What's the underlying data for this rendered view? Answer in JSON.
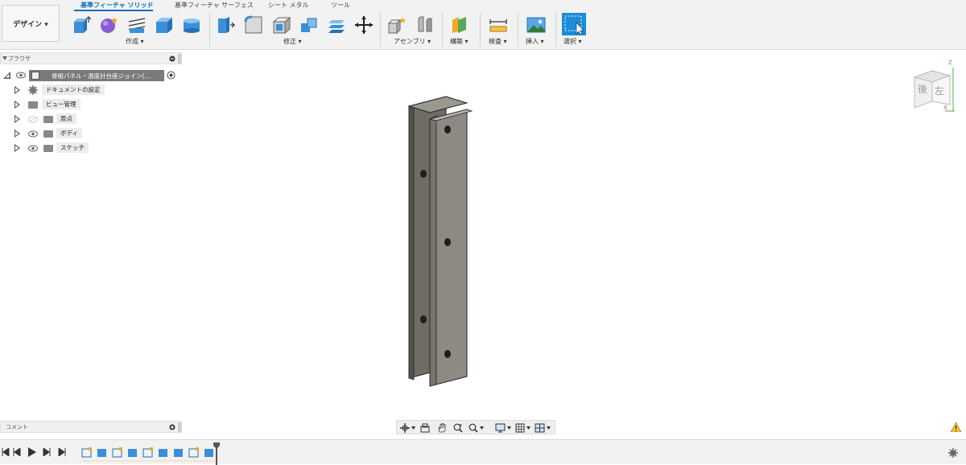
{
  "workspace": {
    "label": "デザイン ▾"
  },
  "tabs": [
    {
      "label": "基準フィーチャ ソリッド",
      "active": true
    },
    {
      "label": "基準フィーチャ サーフェス",
      "active": false
    },
    {
      "label": "シート メタル",
      "active": false
    },
    {
      "label": "ツール",
      "active": false
    }
  ],
  "groups": {
    "create": "作成 ▾",
    "modify": "修正 ▾",
    "assemble": "アセンブリ ▾",
    "construct": "構築 ▾",
    "inspect": "検査 ▾",
    "insert": "挿入 ▾",
    "select": "選択 ▾"
  },
  "colors": {
    "accent": "#0b6fb8",
    "icon_blue": "#3a8fd8",
    "part_dark": "#6f6c64",
    "part_light": "#8c8a82",
    "select_blue": "#1a8cd8"
  },
  "browser": {
    "title": "ブラウザ",
    "root": "骨組パネル・温度計台座ジョイン(...",
    "items": [
      {
        "label": "ドキュメントの設定",
        "icon": "gear-icon"
      },
      {
        "label": "ビュー管理",
        "icon": "folder-icon"
      },
      {
        "label": "原点",
        "icon": "folder-icon"
      },
      {
        "label": "ボディ",
        "icon": "folder-icon"
      },
      {
        "label": "スケッチ",
        "icon": "folder-icon"
      }
    ]
  },
  "comments": {
    "title": "コメント"
  },
  "viewcube": {
    "face_back": "後",
    "face_left": "左",
    "axis_z": "Z",
    "axis_x": "X"
  }
}
